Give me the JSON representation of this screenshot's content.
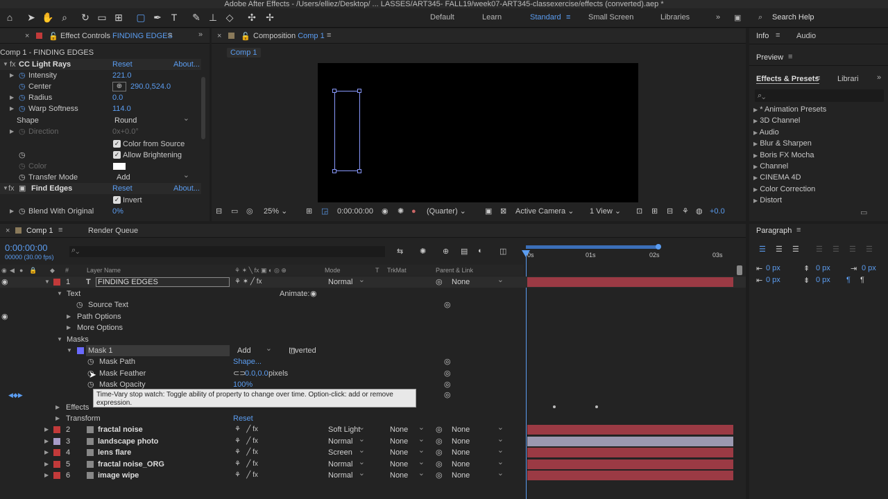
{
  "app": {
    "title": "Adobe After Effects - /Users/elliez/Desktop/ ... LASSES/ART345- FALL19/week07-ART345-classexercise/effects (converted).aep *"
  },
  "workspaces": [
    "Default",
    "Learn",
    "Standard",
    "Small Screen",
    "Libraries"
  ],
  "search_help": "Search Help",
  "effect_controls": {
    "tab_prefix": "Effect Controls",
    "tab_layer": "FINDING EDGES",
    "header": "Comp 1 - FINDING EDGES",
    "light_rays": {
      "name": "CC Light Rays",
      "reset": "Reset",
      "about": "About...",
      "props": [
        {
          "label": "Intensity",
          "value": "221.0"
        },
        {
          "label": "Center",
          "value": "290.0,524.0"
        },
        {
          "label": "Radius",
          "value": "0.0"
        },
        {
          "label": "Warp Softness",
          "value": "114.0"
        }
      ],
      "shape_label": "Shape",
      "shape_value": "Round",
      "direction_label": "Direction",
      "direction_value": "0x+0.0°",
      "color_from_source": "Color from Source",
      "allow_brightening": "Allow Brightening",
      "color_label": "Color",
      "transfer_mode_label": "Transfer Mode",
      "transfer_mode_value": "Add"
    },
    "find_edges": {
      "name": "Find Edges",
      "reset": "Reset",
      "about": "About...",
      "invert": "Invert",
      "blend_label": "Blend With Original",
      "blend_value": "0%"
    }
  },
  "composition": {
    "tab_prefix": "Composition",
    "tab_name": "Comp 1",
    "crumb": "Comp 1",
    "zoom": "25%",
    "time": "0:00:00:00",
    "resolution": "(Quarter)",
    "camera": "Active Camera",
    "view": "1 View",
    "exposure": "+0.0"
  },
  "right": {
    "info": "Info",
    "audio": "Audio",
    "preview": "Preview",
    "effects_presets": "Effects & Presets",
    "libraries": "Librari",
    "presets": [
      "* Animation Presets",
      "3D Channel",
      "Audio",
      "Blur & Sharpen",
      "Boris FX Mocha",
      "Channel",
      "CINEMA 4D",
      "Color Correction",
      "Distort"
    ],
    "paragraph": "Paragraph",
    "px_values": [
      "0 px",
      "0 px",
      "0 px",
      "0 px",
      "0 px"
    ]
  },
  "timeline": {
    "tab": "Comp 1",
    "render_queue": "Render Queue",
    "time": "0:00:00:00",
    "fps": "00000 (30.00 fps)",
    "cols": {
      "num": "#",
      "name": "Layer Name",
      "mode": "Mode",
      "t": "T",
      "trkmat": "TrkMat",
      "parent": "Parent & Link"
    },
    "ruler": [
      "0s",
      "01s",
      "02s",
      "03s"
    ],
    "layer1": {
      "num": "1",
      "name": "FINDING EDGES",
      "mode": "Normal",
      "parent": "None"
    },
    "text_group": "Text",
    "animate": "Animate:",
    "source_text": "Source Text",
    "path_options": "Path Options",
    "more_options": "More Options",
    "masks": "Masks",
    "mask1": "Mask 1",
    "mask_mode": "Add",
    "inverted": "Inverted",
    "mask_path": "Mask Path",
    "mask_path_val": "Shape...",
    "mask_feather": "Mask Feather",
    "mask_feather_val": "0.0,0.0",
    "mask_feather_unit": "pixels",
    "mask_opacity": "Mask Opacity",
    "mask_opacity_val": "100%",
    "tooltip": "Time-Vary stop watch: Toggle ability of property to change over time. Option-click: add or remove expression.",
    "effects": "Effects",
    "transform": "Transform",
    "transform_reset": "Reset",
    "layers": [
      {
        "num": "2",
        "name": "fractal noise",
        "mode": "Soft Light",
        "trkmat": "None",
        "parent": "None",
        "color": "#c23a3a",
        "bar": "#9b3a44"
      },
      {
        "num": "3",
        "name": "landscape photo",
        "mode": "Normal",
        "trkmat": "None",
        "parent": "None",
        "color": "#a89cc8",
        "bar": "#9b98b0"
      },
      {
        "num": "4",
        "name": "lens flare",
        "mode": "Screen",
        "trkmat": "None",
        "parent": "None",
        "color": "#c23a3a",
        "bar": "#9b3a44"
      },
      {
        "num": "5",
        "name": "fractal noise_ORG",
        "mode": "Normal",
        "trkmat": "None",
        "parent": "None",
        "color": "#c23a3a",
        "bar": "#9b3a44"
      },
      {
        "num": "6",
        "name": "image wipe",
        "mode": "Normal",
        "trkmat": "None",
        "parent": "None",
        "color": "#c23a3a",
        "bar": "#9b3a44"
      }
    ]
  }
}
